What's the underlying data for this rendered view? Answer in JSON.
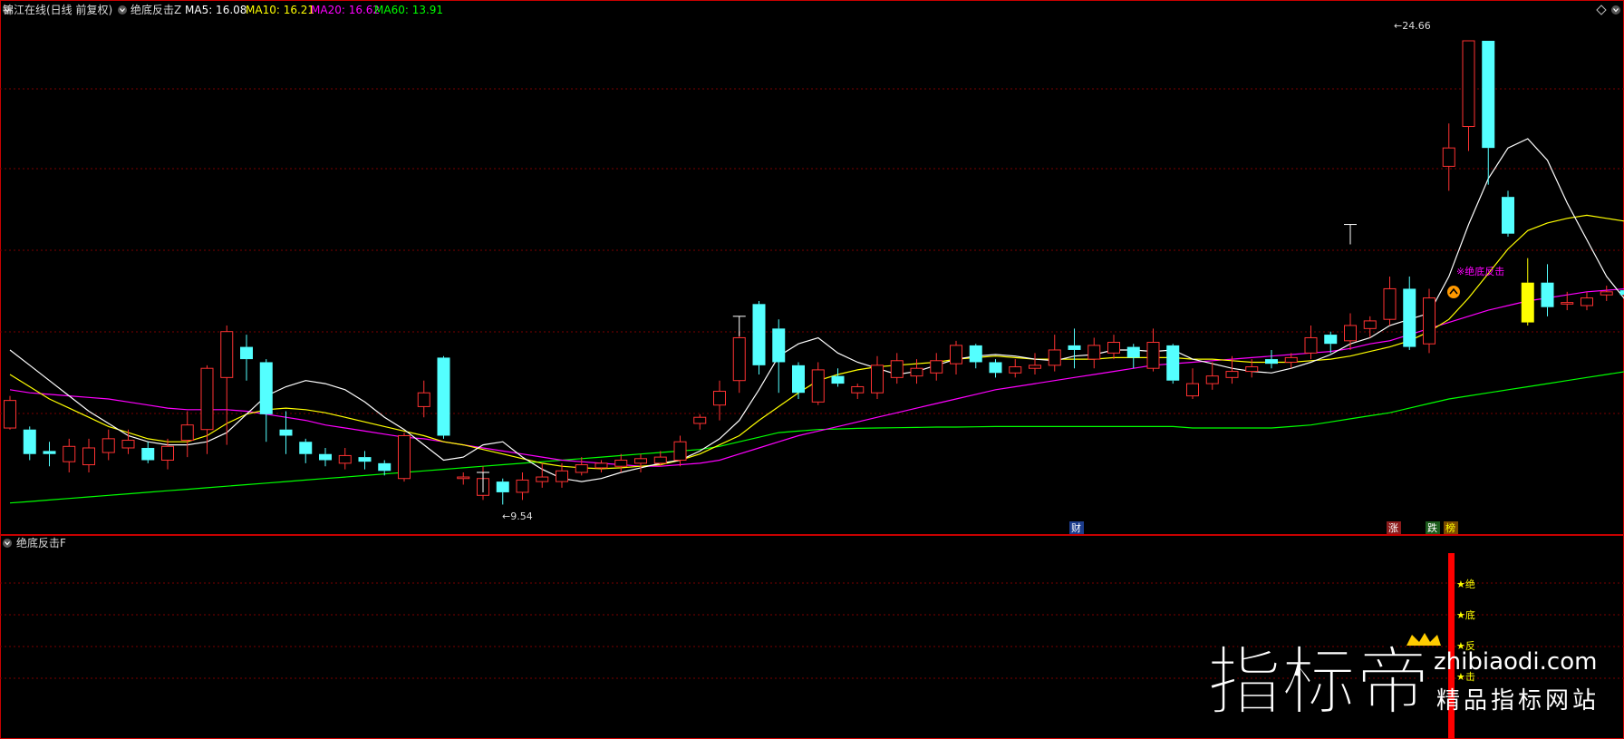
{
  "header": {
    "stock_name": "锦江在线(日线 前复权)",
    "indicator_name": "绝底反击Z",
    "ma5": "MA5: 16.08",
    "ma10": "MA10: 16.21",
    "ma20": "MA20: 16.62",
    "ma60": "MA60: 13.91"
  },
  "sub_panel": {
    "title": "绝底反击F",
    "stars": [
      "★绝",
      "★底",
      "★反",
      "★击"
    ]
  },
  "annotations": {
    "high_label": "←24.66",
    "low_label": "←9.54",
    "signal_label": "※绝底反击",
    "event_cai": "财",
    "event_zhang": "涨",
    "event_die": "跌",
    "event_rong": "榜"
  },
  "watermark": {
    "main": "指标帝",
    "domain": "zhibiaodi.com",
    "slogan": "精品指标网站"
  },
  "colors": {
    "background": "#000000",
    "up_candle": "#ff3232",
    "down_candle": "#54ffff",
    "ma5": "#ffffff",
    "ma10": "#ffff00",
    "ma20": "#ff00ff",
    "ma60": "#00ff00",
    "grid": "#7a0000",
    "signal_bar": "#ff0000",
    "star_text": "#ffff00"
  },
  "chart_data": {
    "type": "candlestick",
    "y_range": [
      9.0,
      25.5
    ],
    "grid": true,
    "candles": [
      [
        12.05,
        12.95,
        13.1,
        12.0
      ],
      [
        12.0,
        11.2,
        12.1,
        11.0
      ],
      [
        11.3,
        11.2,
        11.6,
        10.8
      ],
      [
        10.95,
        11.45,
        11.7,
        10.6
      ],
      [
        10.85,
        11.4,
        11.7,
        10.6
      ],
      [
        11.25,
        11.7,
        12.0,
        11.0
      ],
      [
        11.4,
        11.65,
        12.0,
        11.2
      ],
      [
        11.4,
        11.0,
        11.6,
        10.9
      ],
      [
        11.0,
        11.45,
        11.7,
        10.7
      ],
      [
        11.65,
        12.15,
        12.6,
        11.1
      ],
      [
        12.0,
        14.0,
        14.1,
        11.2
      ],
      [
        13.7,
        15.2,
        15.4,
        11.5
      ],
      [
        14.7,
        14.3,
        15.1,
        13.6
      ],
      [
        14.2,
        12.5,
        14.3,
        11.6
      ],
      [
        12.0,
        11.8,
        12.6,
        11.2
      ],
      [
        11.6,
        11.2,
        11.7,
        10.9
      ],
      [
        11.2,
        11.0,
        11.4,
        10.8
      ],
      [
        10.9,
        11.15,
        11.4,
        10.7
      ],
      [
        11.1,
        10.95,
        11.3,
        10.7
      ],
      [
        10.9,
        10.65,
        11.0,
        10.5
      ],
      [
        10.4,
        11.8,
        11.9,
        10.3
      ],
      [
        12.75,
        13.2,
        13.6,
        12.4
      ],
      [
        14.35,
        11.8,
        14.4,
        11.7
      ],
      [
        10.4,
        10.45,
        10.6,
        10.2
      ],
      [
        9.85,
        10.4,
        10.8,
        9.7
      ],
      [
        10.3,
        9.95,
        10.4,
        9.55
      ],
      [
        9.95,
        10.35,
        10.6,
        9.7
      ],
      [
        10.3,
        10.45,
        10.9,
        10.1
      ],
      [
        10.3,
        10.65,
        10.9,
        10.1
      ],
      [
        10.6,
        10.85,
        11.1,
        10.5
      ],
      [
        10.75,
        10.9,
        11.0,
        10.6
      ],
      [
        10.8,
        11.0,
        11.2,
        10.6
      ],
      [
        10.9,
        11.05,
        11.2,
        10.6
      ],
      [
        10.9,
        11.1,
        11.3,
        10.8
      ],
      [
        11.0,
        11.6,
        11.8,
        10.8
      ],
      [
        12.2,
        12.4,
        12.5,
        12.0
      ],
      [
        12.8,
        13.25,
        13.6,
        12.3
      ],
      [
        13.6,
        15.0,
        15.2,
        13.2
      ],
      [
        16.1,
        14.1,
        16.2,
        13.8
      ],
      [
        15.3,
        14.2,
        15.6,
        13.2
      ],
      [
        14.1,
        13.2,
        14.2,
        13.0
      ],
      [
        12.9,
        13.95,
        14.2,
        12.8
      ],
      [
        13.75,
        13.5,
        14.0,
        13.4
      ],
      [
        13.2,
        13.4,
        13.5,
        13.0
      ],
      [
        13.2,
        14.1,
        14.4,
        13.0
      ],
      [
        13.7,
        14.25,
        14.5,
        13.5
      ],
      [
        13.75,
        14.0,
        14.3,
        13.5
      ],
      [
        13.85,
        14.25,
        14.5,
        13.6
      ],
      [
        14.15,
        14.75,
        14.9,
        13.8
      ],
      [
        14.75,
        14.2,
        14.8,
        14.0
      ],
      [
        14.2,
        13.85,
        14.3,
        13.7
      ],
      [
        13.85,
        14.05,
        14.3,
        13.7
      ],
      [
        14.0,
        14.1,
        14.5,
        13.8
      ],
      [
        14.1,
        14.6,
        15.1,
        13.9
      ],
      [
        14.75,
        14.6,
        15.3,
        14.0
      ],
      [
        14.3,
        14.75,
        15.0,
        14.0
      ],
      [
        14.5,
        14.85,
        15.1,
        14.3
      ],
      [
        14.7,
        14.35,
        14.8,
        14.0
      ],
      [
        14.0,
        14.85,
        15.3,
        13.9
      ],
      [
        14.75,
        13.6,
        14.8,
        13.5
      ],
      [
        13.1,
        13.5,
        14.0,
        13.0
      ],
      [
        13.5,
        13.75,
        14.2,
        13.3
      ],
      [
        13.7,
        13.9,
        14.4,
        13.5
      ],
      [
        13.9,
        14.05,
        14.3,
        13.7
      ],
      [
        14.3,
        14.15,
        14.6,
        14.0
      ],
      [
        14.2,
        14.35,
        14.5,
        14.0
      ],
      [
        14.5,
        15.0,
        15.4,
        14.3
      ],
      [
        15.1,
        14.8,
        15.2,
        14.5
      ],
      [
        14.9,
        15.4,
        15.8,
        14.6
      ],
      [
        15.3,
        15.55,
        15.7,
        15.0
      ],
      [
        15.6,
        16.6,
        17.0,
        15.4
      ],
      [
        16.6,
        14.7,
        17.0,
        14.6
      ],
      [
        14.8,
        16.3,
        16.6,
        14.5
      ],
      [
        20.6,
        21.2,
        22.0,
        19.8
      ],
      [
        21.9,
        24.7,
        24.7,
        21.1
      ],
      [
        24.7,
        21.2,
        24.7,
        20.0
      ],
      [
        19.6,
        18.4,
        19.8,
        18.3
      ],
      [
        16.8,
        15.5,
        17.6,
        15.4
      ],
      [
        16.8,
        16.0,
        17.4,
        15.7
      ],
      [
        16.1,
        16.15,
        16.5,
        15.9
      ],
      [
        16.05,
        16.3,
        16.5,
        15.9
      ],
      [
        16.4,
        16.5,
        16.7,
        16.2
      ],
      [
        16.55,
        16.4,
        16.7,
        16.2
      ],
      [
        16.35,
        16.15,
        16.4,
        15.9
      ],
      [
        15.95,
        16.1,
        16.4,
        15.8
      ],
      [
        16.2,
        16.35,
        16.5,
        15.9
      ],
      [
        16.35,
        16.45,
        16.8,
        16.2
      ],
      [
        16.5,
        17.3,
        17.4,
        15.9
      ]
    ],
    "ma5": [
      14.6,
      14.1,
      13.6,
      13.1,
      12.6,
      12.2,
      11.8,
      11.6,
      11.5,
      11.5,
      11.6,
      11.9,
      12.5,
      13.1,
      13.4,
      13.6,
      13.5,
      13.3,
      12.9,
      12.4,
      12.0,
      11.5,
      11.0,
      11.1,
      11.5,
      11.6,
      11.1,
      10.7,
      10.4,
      10.3,
      10.4,
      10.6,
      10.75,
      10.9,
      11.0,
      11.3,
      11.7,
      12.3,
      13.3,
      14.4,
      14.8,
      15.0,
      14.5,
      14.2,
      14.0,
      13.8,
      13.9,
      14.1,
      14.3,
      14.4,
      14.45,
      14.4,
      14.3,
      14.25,
      14.4,
      14.45,
      14.6,
      14.6,
      14.55,
      14.6,
      14.3,
      14.15,
      14.0,
      13.9,
      13.85,
      14.0,
      14.2,
      14.45,
      14.8,
      15.0,
      15.4,
      15.6,
      15.8,
      17.0,
      18.7,
      20.2,
      21.2,
      21.5,
      20.8,
      19.4,
      18.2,
      17.0,
      16.2,
      16.2,
      16.3,
      16.3,
      16.4,
      16.5
    ],
    "ma10": [
      13.8,
      13.4,
      13.0,
      12.7,
      12.4,
      12.1,
      11.9,
      11.7,
      11.6,
      11.6,
      11.8,
      12.2,
      12.5,
      12.65,
      12.7,
      12.65,
      12.55,
      12.4,
      12.25,
      12.1,
      11.95,
      11.8,
      11.6,
      11.5,
      11.35,
      11.2,
      11.05,
      10.9,
      10.8,
      10.75,
      10.72,
      10.75,
      10.8,
      10.85,
      11.0,
      11.2,
      11.5,
      11.8,
      12.3,
      12.75,
      13.2,
      13.6,
      13.8,
      13.95,
      14.05,
      14.1,
      14.15,
      14.2,
      14.3,
      14.35,
      14.4,
      14.35,
      14.3,
      14.3,
      14.3,
      14.3,
      14.35,
      14.35,
      14.35,
      14.35,
      14.3,
      14.3,
      14.25,
      14.2,
      14.2,
      14.2,
      14.25,
      14.3,
      14.4,
      14.55,
      14.7,
      14.9,
      15.2,
      15.6,
      16.3,
      17.1,
      17.9,
      18.5,
      18.75,
      18.9,
      19.0,
      18.9,
      18.8,
      18.55,
      18.3,
      18.0,
      17.6,
      17.0
    ],
    "ma20": [
      13.3,
      13.2,
      13.15,
      13.1,
      13.05,
      13.0,
      12.9,
      12.8,
      12.7,
      12.65,
      12.65,
      12.65,
      12.6,
      12.5,
      12.4,
      12.3,
      12.15,
      12.05,
      11.95,
      11.85,
      11.75,
      11.7,
      11.6,
      11.5,
      11.4,
      11.3,
      11.2,
      11.1,
      11.0,
      10.95,
      10.9,
      10.85,
      10.8,
      10.8,
      10.85,
      10.9,
      11.0,
      11.2,
      11.4,
      11.6,
      11.8,
      11.95,
      12.1,
      12.25,
      12.4,
      12.55,
      12.7,
      12.85,
      13.0,
      13.15,
      13.3,
      13.4,
      13.5,
      13.6,
      13.7,
      13.8,
      13.9,
      14.0,
      14.1,
      14.15,
      14.2,
      14.25,
      14.3,
      14.35,
      14.4,
      14.45,
      14.5,
      14.55,
      14.65,
      14.8,
      14.9,
      15.1,
      15.3,
      15.5,
      15.7,
      15.9,
      16.05,
      16.2,
      16.3,
      16.4,
      16.5,
      16.55,
      16.6,
      16.65,
      16.7,
      16.75,
      16.8,
      16.9
    ],
    "ma60": [
      9.6,
      9.65,
      9.7,
      9.75,
      9.8,
      9.85,
      9.9,
      9.95,
      10.0,
      10.05,
      10.1,
      10.15,
      10.2,
      10.25,
      10.3,
      10.35,
      10.4,
      10.45,
      10.5,
      10.55,
      10.6,
      10.65,
      10.7,
      10.75,
      10.8,
      10.85,
      10.9,
      10.95,
      11.0,
      11.05,
      11.1,
      11.15,
      11.2,
      11.25,
      11.3,
      11.35,
      11.45,
      11.6,
      11.75,
      11.9,
      11.95,
      12.0,
      12.02,
      12.04,
      12.05,
      12.06,
      12.07,
      12.08,
      12.08,
      12.09,
      12.1,
      12.1,
      12.1,
      12.1,
      12.1,
      12.1,
      12.1,
      12.1,
      12.1,
      12.1,
      12.05,
      12.05,
      12.05,
      12.05,
      12.05,
      12.1,
      12.15,
      12.25,
      12.35,
      12.45,
      12.55,
      12.7,
      12.85,
      13.0,
      13.1,
      13.2,
      13.3,
      13.4,
      13.5,
      13.6,
      13.7,
      13.8,
      13.9,
      14.0,
      14.1,
      14.2,
      14.3,
      14.4
    ],
    "max_label_index": 74,
    "min_label_index": 25,
    "signal_index": 77,
    "doji_markers": [
      [
        24,
        10.6
      ],
      [
        37,
        15.7
      ],
      [
        68,
        18.7
      ]
    ]
  }
}
